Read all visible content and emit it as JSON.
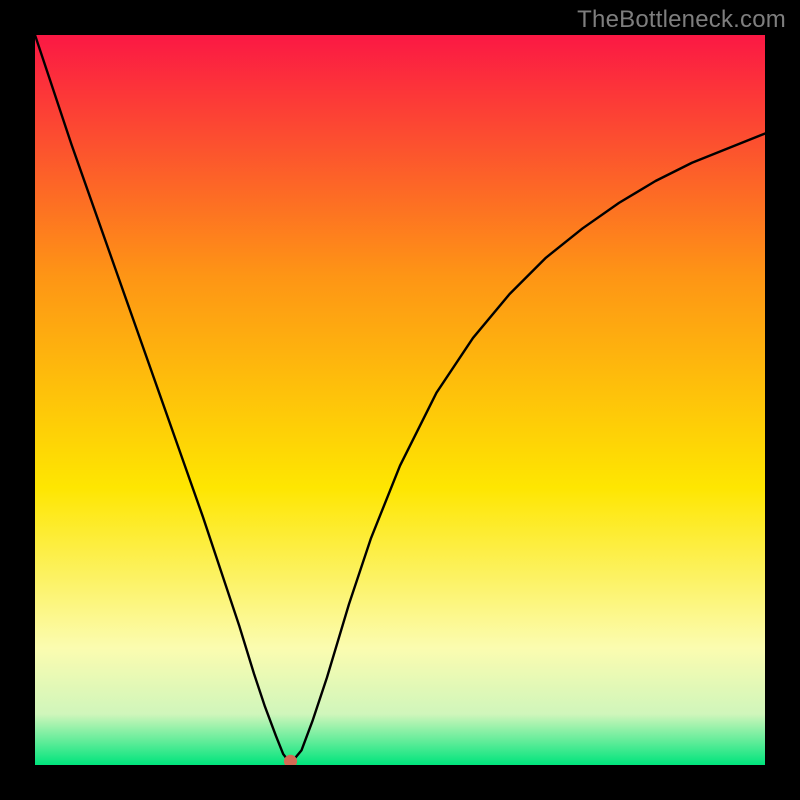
{
  "watermark": "TheBottleneck.com",
  "chart_data": {
    "type": "line",
    "title": "",
    "xlabel": "",
    "ylabel": "",
    "xlim": [
      0,
      100
    ],
    "ylim": [
      0,
      100
    ],
    "grid": false,
    "legend": false,
    "background_gradient": {
      "top": "#fb1844",
      "upper_mid": "#fe9515",
      "mid": "#fee601",
      "lower_mid": "#fbfcb0",
      "near_bottom": "#d0f6bb",
      "bottom": "#00e47c"
    },
    "series": [
      {
        "name": "bottleneck-curve",
        "color": "#000000",
        "x": [
          0,
          2,
          5,
          8,
          11,
          14,
          17,
          20,
          23,
          26,
          28,
          30,
          31.5,
          33,
          34,
          35,
          36.5,
          38,
          40,
          43,
          46,
          50,
          55,
          60,
          65,
          70,
          75,
          80,
          85,
          90,
          95,
          100
        ],
        "y": [
          100,
          94,
          85,
          76.5,
          68,
          59.5,
          51,
          42.5,
          34,
          25,
          19,
          12.5,
          8,
          4,
          1.5,
          0.2,
          2,
          6,
          12,
          22,
          31,
          41,
          51,
          58.5,
          64.5,
          69.5,
          73.5,
          77,
          80,
          82.5,
          84.5,
          86.5
        ]
      }
    ],
    "marker": {
      "name": "current-point",
      "color": "#d46a54",
      "x": 35,
      "y": 0.5,
      "r_percent": 0.9
    }
  }
}
